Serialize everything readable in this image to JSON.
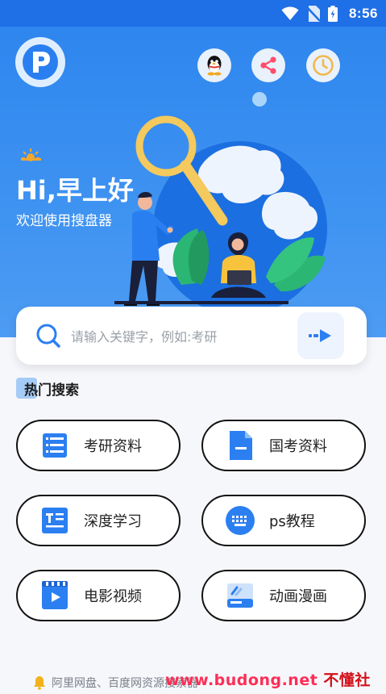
{
  "status_bar": {
    "time": "8:56"
  },
  "header": {
    "greeting": "Hi,早上好",
    "subtitle": "欢迎使用搜盘器",
    "logo_letter": "P",
    "actions": [
      "qq-icon",
      "share-icon",
      "history-icon"
    ]
  },
  "search": {
    "placeholder": "请输入关键字，例如:考研"
  },
  "hot": {
    "title_badge": "热",
    "title": "门搜索",
    "items": [
      {
        "label": "考研资料",
        "icon": "list-icon",
        "color": "#2b7ff1"
      },
      {
        "label": "国考资料",
        "icon": "document-icon",
        "color": "#2b7ff1"
      },
      {
        "label": "深度学习",
        "icon": "text-document-icon",
        "color": "#2b7ff1"
      },
      {
        "label": "ps教程",
        "icon": "keyboard-icon",
        "color": "#2b7ff1"
      },
      {
        "label": "电影视频",
        "icon": "video-icon",
        "color": "#2b7ff1"
      },
      {
        "label": "动画漫画",
        "icon": "tv-icon",
        "color": "#2b7ff1"
      }
    ]
  },
  "footer": {
    "text": "阿里网盘、百度网资源搜索器"
  },
  "watermark": {
    "url": "www.budong.net",
    "brand": "不懂社区"
  },
  "colors": {
    "accent": "#2b7ff1",
    "hero": "#3f93f1"
  }
}
